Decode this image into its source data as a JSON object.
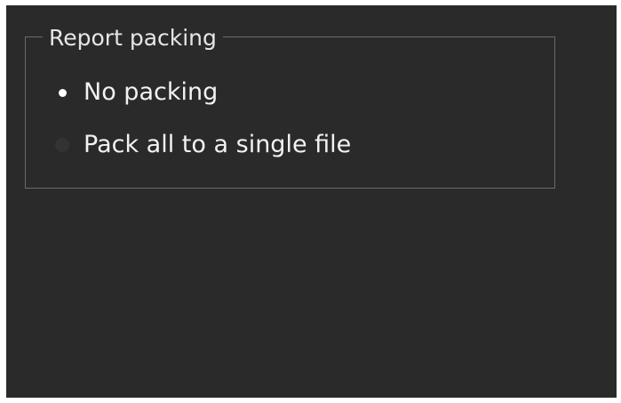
{
  "group": {
    "title": "Report packing",
    "options": [
      {
        "label": "No packing",
        "selected": true
      },
      {
        "label": "Pack all to a single file",
        "selected": false
      }
    ]
  },
  "colors": {
    "background": "#2a2a2a",
    "border": "#6a6a6a",
    "text": "#f2f2f2"
  }
}
